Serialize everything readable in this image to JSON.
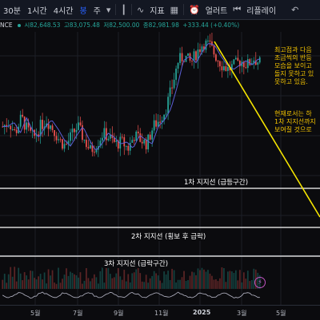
{
  "toolbar": {
    "intervals": [
      "30분",
      "1시간",
      "4시간"
    ],
    "candle_label": "봉",
    "week_label": "주",
    "indicators_label": "지표",
    "alert_label": "얼러트",
    "replay_label": "리플레이"
  },
  "symbol_bar": {
    "symbol_fragment": "NCE",
    "open": "시82,648.53",
    "high": "고83,075.48",
    "low": "저82,500.00",
    "close": "종82,981.98",
    "change": "+333.44 (+0.40%)"
  },
  "notes": {
    "upper": [
      "최고점과 다음",
      "조금씩의 반등",
      "모습을 보이고",
      "돌지 못하고 있",
      "못하고 있음."
    ],
    "lower": [
      "현재로서는 하",
      "1차 지지선까지",
      "보여질 것으로"
    ]
  },
  "levels": {
    "first": "1차 지지선 (급등구간)",
    "second": "2차 지지선 (횡보 후 급락)",
    "third": "3차 지지선 (급락구간)"
  },
  "xaxis": {
    "labels": [
      "5월",
      "7월",
      "9월",
      "11월",
      "2025",
      "3월",
      "5월"
    ]
  },
  "colors": {
    "up": "#26a69a",
    "down": "#ef5350",
    "ma": "#5b5fd6",
    "trendline": "#f7e600",
    "note_text": "#f7c600",
    "support": "#ffffff",
    "background": "#0b0b0e"
  },
  "chart_data": {
    "type": "candlestick",
    "title": "",
    "price_levels": {
      "first_support": "1차 지지선 (급등구간)",
      "second_support": "2차 지지선 (횡보 후 급락)",
      "third_support": "3차 지지선 (급락구간)"
    },
    "x_ticks": [
      "5월",
      "7월",
      "9월",
      "11월",
      "2025",
      "3월",
      "5월"
    ],
    "series": [
      {
        "values": [
          66,
          68,
          63,
          70,
          64,
          61,
          66,
          69,
          65,
          60,
          57,
          62,
          66,
          60,
          55,
          58,
          63,
          61,
          58,
          59,
          56,
          62,
          60,
          58,
          66,
          69,
          74,
          84,
          96,
          98,
          95,
          100,
          104,
          103,
          98,
          94,
          92,
          94,
          96,
          94,
          97,
          95
        ]
      }
    ]
  }
}
